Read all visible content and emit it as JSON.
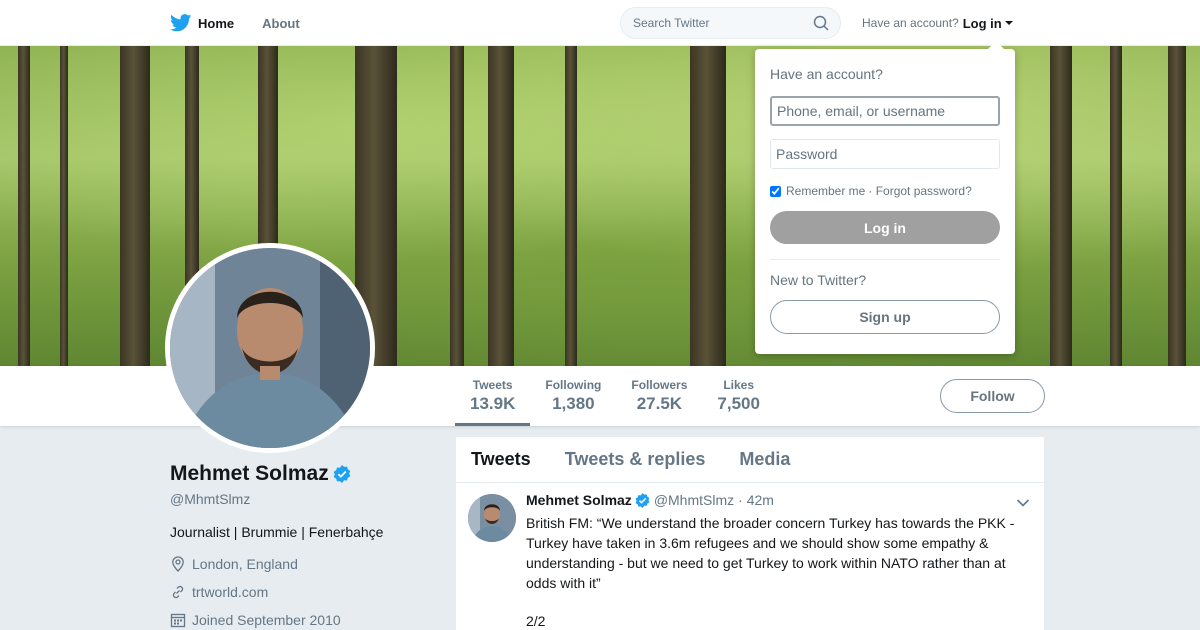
{
  "nav": {
    "home_label": "Home",
    "about_label": "About",
    "search_placeholder": "Search Twitter",
    "have_account_text": "Have an account?",
    "login_label": "Log in"
  },
  "profile": {
    "name": "Mehmet Solmaz",
    "handle": "@MhmtSlmz",
    "bio": "Journalist | Brummie | Fenerbahçe",
    "location": "London, England",
    "website": "trtworld.com",
    "joined": "Joined September 2010",
    "follow_label": "Follow"
  },
  "stats": [
    {
      "label": "Tweets",
      "value": "13.9K"
    },
    {
      "label": "Following",
      "value": "1,380"
    },
    {
      "label": "Followers",
      "value": "27.5K"
    },
    {
      "label": "Likes",
      "value": "7,500"
    }
  ],
  "timeline": {
    "tabs": [
      "Tweets",
      "Tweets & replies",
      "Media"
    ],
    "tweet": {
      "name": "Mehmet Solmaz",
      "handle": "@MhmtSlmz",
      "time": "· 42m",
      "text": "British FM: “We understand the broader concern Turkey has towards the PKK - Turkey have taken in 3.6m refugees and we should show some empathy & understanding - but we need to get Turkey to work within NATO rather than at odds with it”",
      "extra": "2/2"
    }
  },
  "login_dropdown": {
    "title": "Have an account?",
    "username_placeholder": "Phone, email, or username",
    "password_placeholder": "Password",
    "remember_label": "Remember me",
    "forgot_label": "· Forgot password?",
    "login_button": "Log in",
    "new_text": "New to Twitter?",
    "signup_button": "Sign up"
  },
  "colors": {
    "brand_blue": "#1da1f2",
    "verified_blue": "#1da1f2",
    "text_secondary": "#657786"
  },
  "icons": [
    "twitter-bird-icon",
    "search-icon",
    "verified-badge-icon",
    "location-icon",
    "link-icon",
    "calendar-icon",
    "chevron-down-icon"
  ]
}
